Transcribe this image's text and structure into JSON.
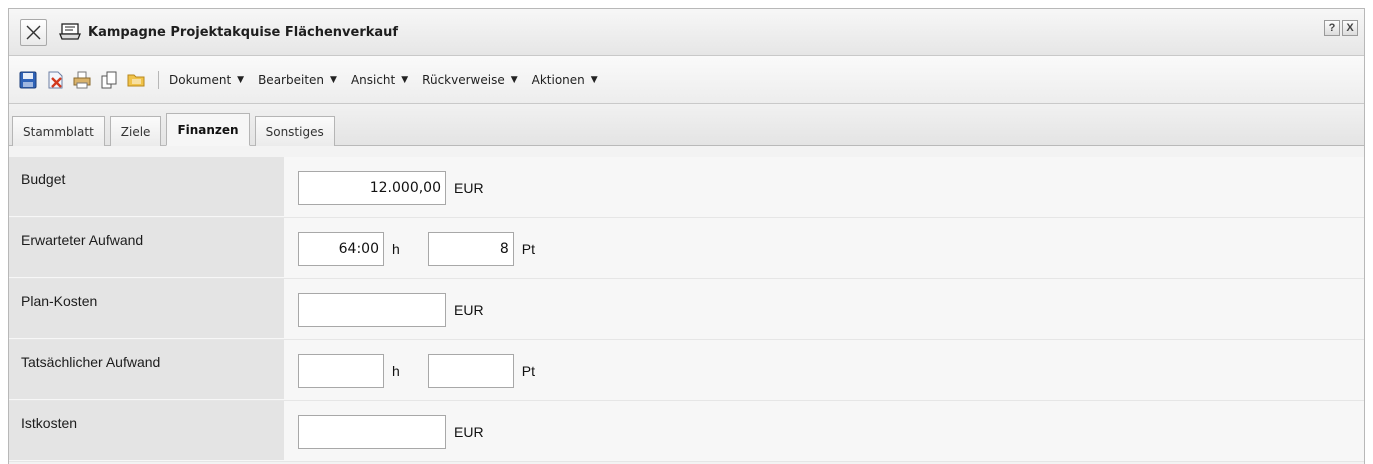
{
  "window": {
    "title": "Kampagne Projektakquise Flächenverkauf",
    "help_label": "?",
    "close_label": "X"
  },
  "toolbar": {
    "icons": [
      "save-icon",
      "delete-icon",
      "print-icon",
      "copy-icon",
      "folder-icon"
    ],
    "menus": [
      {
        "label": "Dokument"
      },
      {
        "label": "Bearbeiten"
      },
      {
        "label": "Ansicht"
      },
      {
        "label": "Rückverweise"
      },
      {
        "label": "Aktionen"
      }
    ]
  },
  "tabs": [
    {
      "label": "Stammblatt",
      "active": false
    },
    {
      "label": "Ziele",
      "active": false
    },
    {
      "label": "Finanzen",
      "active": true
    },
    {
      "label": "Sonstiges",
      "active": false
    }
  ],
  "form": {
    "budget": {
      "label": "Budget",
      "value": "12.000,00",
      "unit": "EUR"
    },
    "erwarteter_aufwand": {
      "label": "Erwarteter Aufwand",
      "hours_value": "64:00",
      "hours_unit": "h",
      "days_value": "8",
      "days_unit": "Pt"
    },
    "plan_kosten": {
      "label": "Plan-Kosten",
      "value": "",
      "unit": "EUR"
    },
    "tatsaechlicher_aufwand": {
      "label": "Tatsächlicher Aufwand",
      "hours_value": "",
      "hours_unit": "h",
      "days_value": "",
      "days_unit": "Pt"
    },
    "istkosten": {
      "label": "Istkosten",
      "value": "",
      "unit": "EUR"
    }
  }
}
